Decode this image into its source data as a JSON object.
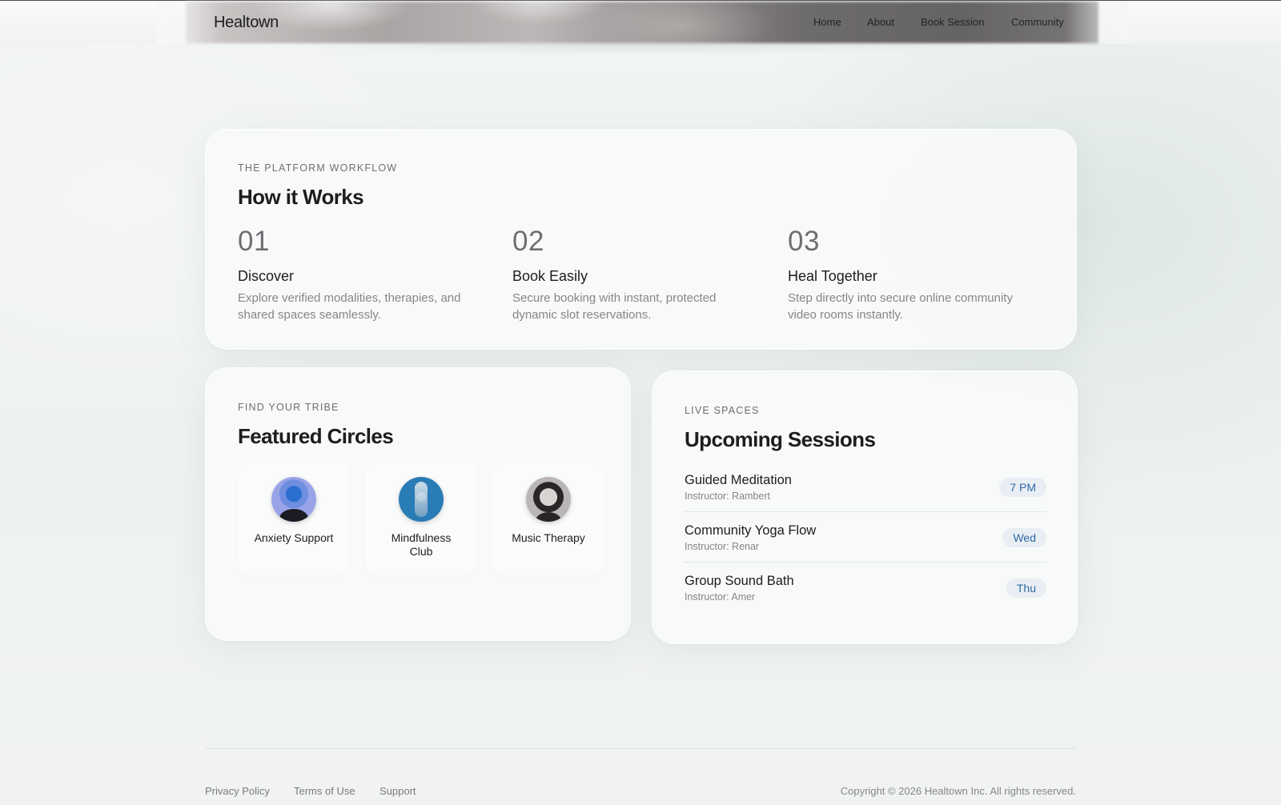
{
  "header": {
    "brand": "Healtown",
    "nav": [
      "Home",
      "About",
      "Book Session",
      "Community"
    ]
  },
  "how_it_works": {
    "eyebrow": "THE PLATFORM WORKFLOW",
    "title": "How it Works",
    "steps": [
      {
        "number": "01",
        "title": "Discover",
        "description": "Explore verified modalities, therapies, and shared spaces seamlessly."
      },
      {
        "number": "02",
        "title": "Book Easily",
        "description": "Secure booking with instant, protected dynamic slot reservations."
      },
      {
        "number": "03",
        "title": "Heal Together",
        "description": "Step directly into secure online community video rooms instantly."
      }
    ]
  },
  "featured_circles": {
    "eyebrow": "FIND YOUR TRIBE",
    "title": "Featured Circles",
    "circles": [
      {
        "label": "Anxiety Support"
      },
      {
        "label": "Mindfulness Club"
      },
      {
        "label": "Music Therapy"
      }
    ]
  },
  "upcoming_sessions": {
    "eyebrow": "LIVE SPACES",
    "title": "Upcoming Sessions",
    "sessions": [
      {
        "name": "Guided Meditation",
        "instructor": "Instructor: Rambert",
        "time": "7 PM"
      },
      {
        "name": "Community Yoga Flow",
        "instructor": "Instructor: Renar",
        "time": "Wed"
      },
      {
        "name": "Group Sound Bath",
        "instructor": "Instructor: Amer",
        "time": "Thu"
      }
    ]
  },
  "footer": {
    "links": [
      "Privacy Policy",
      "Terms of Use",
      "Support"
    ],
    "copyright": "Copyright © 2026 Healtown Inc. All rights reserved."
  },
  "colors": {
    "accent_pill_text": "#2f6aa8",
    "accent_pill_bg": "#e8eef3",
    "page_background": "#eef2f1"
  }
}
